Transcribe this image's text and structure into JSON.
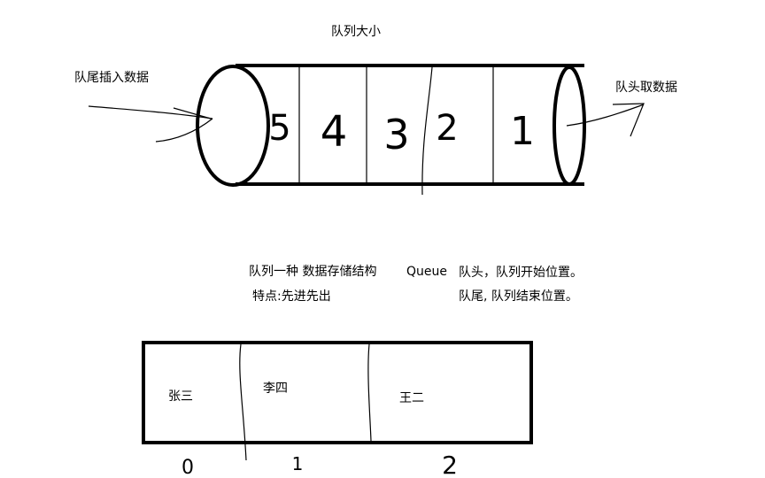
{
  "queue_diagram": {
    "size_label": "队列大小",
    "tail_label": "队尾插入数据",
    "head_label": "队头取数据",
    "cells": [
      "5",
      "4",
      "3",
      "2",
      "1"
    ]
  },
  "description": {
    "line1": "队列一种 数据存储结构",
    "line2": "特点:先进先出",
    "queue_word": "Queue",
    "head_desc": "队头，队列开始位置。",
    "tail_desc": "队尾, 队列结束位置。"
  },
  "array_diagram": {
    "cells": [
      "张三",
      "李四",
      "王二"
    ],
    "indices": [
      "0",
      "1",
      "2"
    ]
  }
}
